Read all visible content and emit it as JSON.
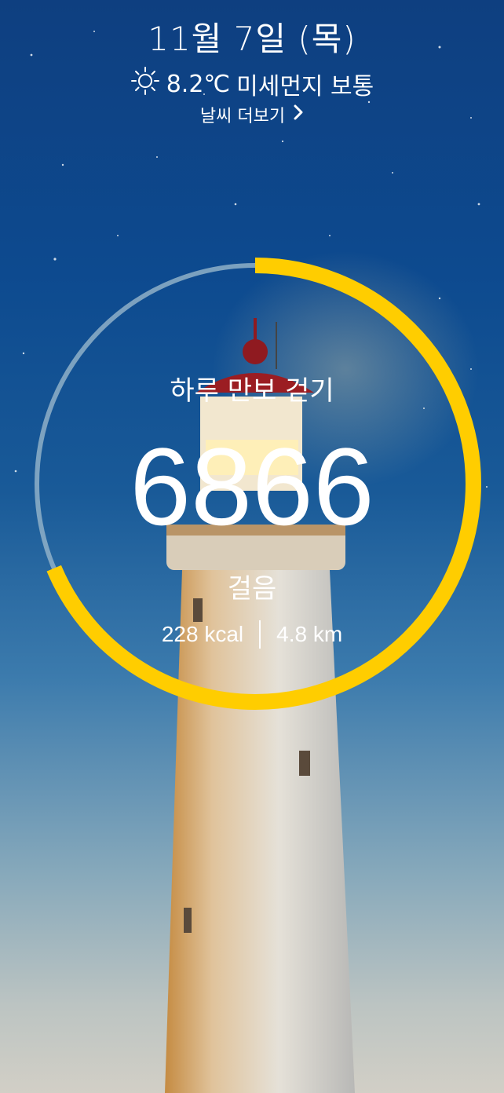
{
  "date": "11월 7일 (목)",
  "weather": {
    "icon": "sun-icon",
    "temperature": "8.2℃",
    "dust": "미세먼지 보통"
  },
  "more_weather": {
    "label": "날씨 더보기",
    "icon": "chevron-right-icon"
  },
  "walk": {
    "title": "하루 만보 걷기",
    "steps": "6866",
    "unit": "걸음",
    "kcal": "228 kcal",
    "distance": "4.8 km",
    "progress": 0.6866
  },
  "colors": {
    "progress": "#ffcd00",
    "track": "#8fb0c8"
  }
}
